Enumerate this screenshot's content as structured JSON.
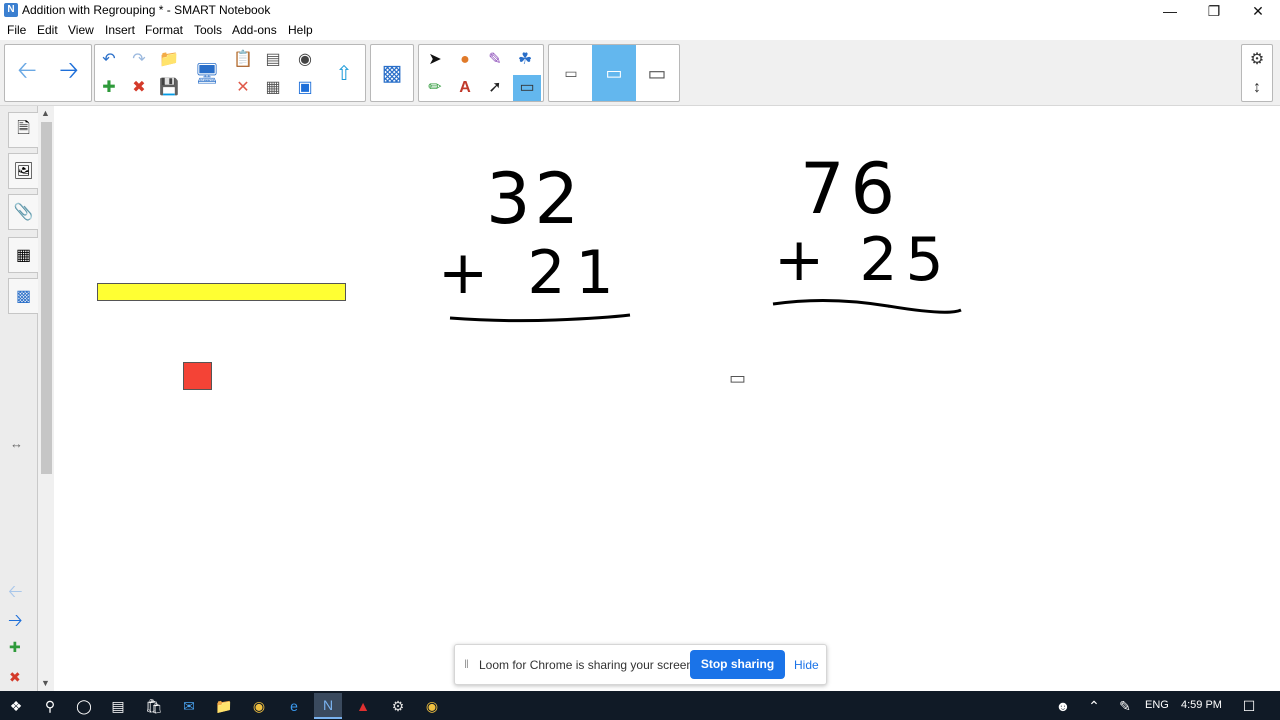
{
  "window": {
    "title": "Addition with Regrouping * - SMART Notebook",
    "app_icon": "smart-notebook-icon",
    "controls": [
      "minimize",
      "restore",
      "close"
    ]
  },
  "menu": [
    "File",
    "Edit",
    "View",
    "Insert",
    "Format",
    "Tools",
    "Add-ons",
    "Help"
  ],
  "toolbar": {
    "groups": [
      [
        "back-arrow-icon",
        "forward-arrow-icon"
      ],
      [
        "undo-icon",
        "redo-icon",
        "open-file-icon",
        "new-page-icon",
        "delete-page-icon",
        "save-icon",
        "display-screen-icon",
        "paste-icon",
        "delete-x-icon",
        "screen-shade-icon",
        "table-icon",
        "spotlight-icon",
        "full-screen-icon",
        "share-icon"
      ],
      [
        "add-ons-puzzle-icon"
      ],
      [
        "select-arrow-icon",
        "shapes-icon",
        "magic-pen-icon",
        "fill-icon",
        "pens-icon",
        "text-icon",
        "lines-icon",
        "eraser-icon"
      ],
      [
        "eraser-small-icon",
        "eraser-medium-icon",
        "eraser-large-icon"
      ]
    ],
    "active_tool": "eraser-medium-icon",
    "accent_color": "#63b7ee"
  },
  "sidebar": {
    "tabs": [
      "page-sorter-icon",
      "gallery-icon",
      "attachments-icon",
      "properties-icon",
      "add-ons-icon"
    ],
    "bottom": [
      "back-arrow-icon",
      "forward-arrow-icon",
      "add-page-icon",
      "delete-page-icon"
    ]
  },
  "canvas": {
    "problem1": {
      "top": "32",
      "bottom": "+ 21"
    },
    "problem2": {
      "top": "76",
      "bottom": "+ 25"
    },
    "shapes": {
      "yellow_bar_color": "#ffff33",
      "red_square_color": "#f44336"
    }
  },
  "loom": {
    "message": "Loom for Chrome is sharing your screen.",
    "stop_label": "Stop sharing",
    "hide_label": "Hide"
  },
  "taskbar": {
    "apps": [
      "windows-start-icon",
      "search-icon",
      "cortana-icon",
      "task-view-icon",
      "store-icon",
      "mail-icon",
      "file-explorer-icon",
      "chrome-icon",
      "edge-icon",
      "smart-notebook-icon",
      "acrobat-icon",
      "app-icon",
      "chrome-icon"
    ],
    "lang": "ENG",
    "time": "4:59 PM"
  }
}
